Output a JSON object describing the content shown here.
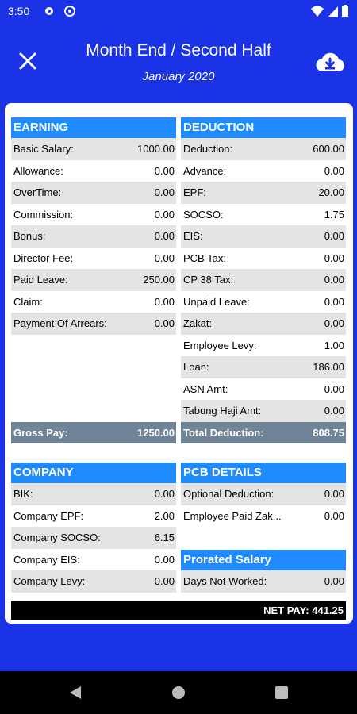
{
  "status_bar": {
    "time": "3:50"
  },
  "header": {
    "title": "Month End / Second Half",
    "subtitle": "January 2020"
  },
  "earning": {
    "heading": "EARNING",
    "rows": [
      {
        "label": "Basic Salary:",
        "value": "1000.00"
      },
      {
        "label": "Allowance:",
        "value": "0.00"
      },
      {
        "label": "OverTime:",
        "value": "0.00"
      },
      {
        "label": "Commission:",
        "value": "0.00"
      },
      {
        "label": "Bonus:",
        "value": "0.00"
      },
      {
        "label": "Director Fee:",
        "value": "0.00"
      },
      {
        "label": "Paid Leave:",
        "value": "250.00"
      },
      {
        "label": "Claim:",
        "value": "0.00"
      },
      {
        "label": "Payment Of Arrears:",
        "value": "0.00"
      }
    ],
    "total_label": "Gross Pay:",
    "total_value": "1250.00"
  },
  "deduction": {
    "heading": "DEDUCTION",
    "rows": [
      {
        "label": "Deduction:",
        "value": "600.00"
      },
      {
        "label": "Advance:",
        "value": "0.00"
      },
      {
        "label": "EPF:",
        "value": "20.00"
      },
      {
        "label": "SOCSO:",
        "value": "1.75"
      },
      {
        "label": "EIS:",
        "value": "0.00"
      },
      {
        "label": "PCB Tax:",
        "value": "0.00"
      },
      {
        "label": "CP 38 Tax:",
        "value": "0.00"
      },
      {
        "label": "Unpaid Leave:",
        "value": "0.00"
      },
      {
        "label": "Zakat:",
        "value": "0.00"
      },
      {
        "label": "Employee Levy:",
        "value": "1.00"
      },
      {
        "label": "Loan:",
        "value": "186.00"
      },
      {
        "label": "ASN Amt:",
        "value": "0.00"
      },
      {
        "label": "Tabung Haji Amt:",
        "value": "0.00"
      }
    ],
    "total_label": "Total Deduction:",
    "total_value": "808.75"
  },
  "company": {
    "heading": "COMPANY",
    "rows": [
      {
        "label": "BIK:",
        "value": "0.00"
      },
      {
        "label": "Company EPF:",
        "value": "2.00"
      },
      {
        "label": "Company SOCSO:",
        "value": "6.15"
      },
      {
        "label": "Company EIS:",
        "value": "0.00"
      },
      {
        "label": "Company Levy:",
        "value": "0.00"
      }
    ]
  },
  "pcb": {
    "heading": "PCB DETAILS",
    "rows": [
      {
        "label": "Optional Deduction:",
        "value": "0.00"
      },
      {
        "label": "Employee Paid Zak...",
        "value": "0.00"
      }
    ]
  },
  "prorated": {
    "heading": "Prorated Salary",
    "rows": [
      {
        "label": "Days Not Worked:",
        "value": "0.00"
      }
    ]
  },
  "net_pay": "NET PAY: 441.25",
  "icons": {
    "close": "close-icon",
    "download": "cloud-download-icon",
    "back": "back-icon",
    "home": "home-icon",
    "recents": "recents-icon"
  },
  "colors": {
    "background": "#1a33e6",
    "section_header": "#1f8bff",
    "total_bar": "#6f8496",
    "row_shade": "#e4e4e4"
  }
}
